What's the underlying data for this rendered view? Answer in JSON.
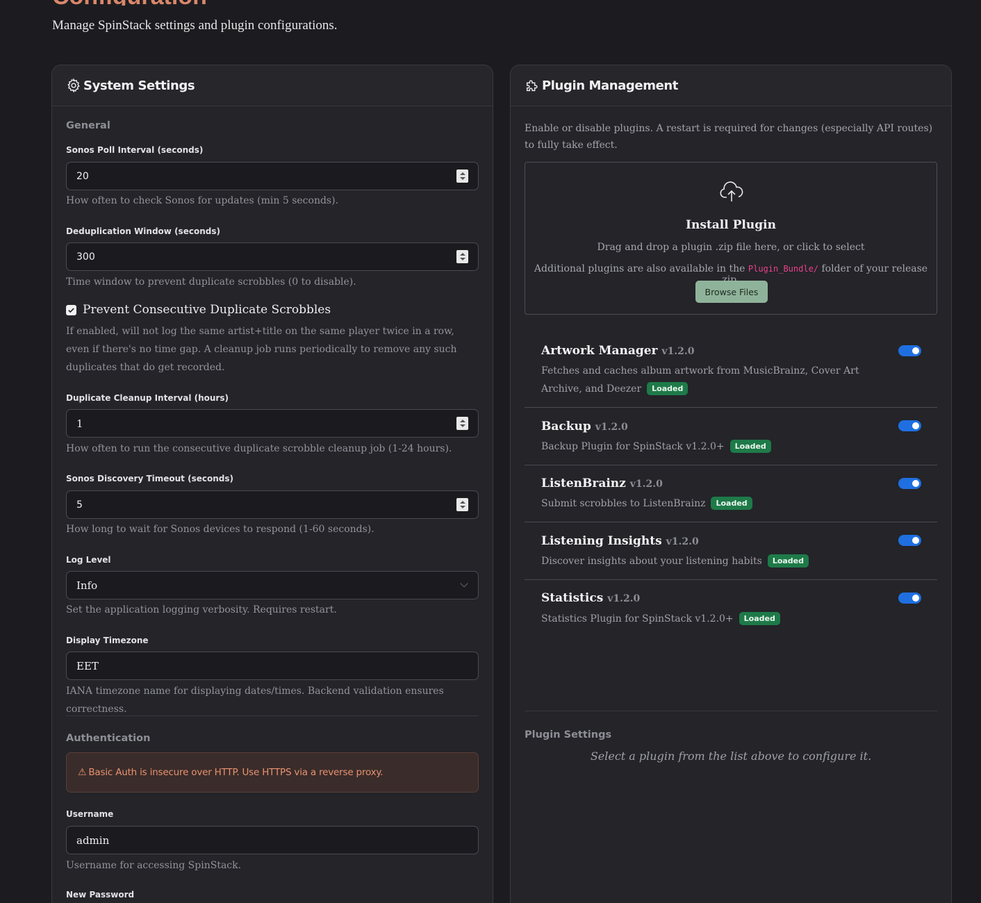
{
  "page": {
    "title": "Configuration",
    "subtitle": "Manage SpinStack settings and plugin configurations."
  },
  "system": {
    "title": "System Settings",
    "icon": "gear-icon",
    "general_title": "General",
    "poll_label": "Sonos Poll Interval (seconds)",
    "poll_value": "20",
    "poll_help": "How often to check Sonos for updates (min 5 seconds).",
    "dedup_label": "Deduplication Window (seconds)",
    "dedup_value": "300",
    "dedup_help": "Time window to prevent duplicate scrobbles (0 to disable).",
    "consecutive_label": "Prevent Consecutive Duplicate Scrobbles",
    "consecutive_checked": true,
    "consecutive_help": "If enabled, will not log the same artist+title on the same player twice in a row, even if there's no time gap. A cleanup job runs periodically to remove any such duplicates that do get recorded.",
    "cleanup_label": "Duplicate Cleanup Interval (hours)",
    "cleanup_value": "1",
    "cleanup_help": "How often to run the consecutive duplicate scrobble cleanup job (1-24 hours).",
    "discovery_label": "Sonos Discovery Timeout (seconds)",
    "discovery_value": "5",
    "discovery_help": "How long to wait for Sonos devices to respond (1-60 seconds).",
    "log_label": "Log Level",
    "log_value": "Info",
    "log_help": "Set the application logging verbosity. Requires restart.",
    "tz_label": "Display Timezone",
    "tz_value": "EET",
    "tz_help": "IANA timezone name for displaying dates/times. Backend validation ensures correctness.",
    "auth_title": "Authentication",
    "auth_warning": "Basic Auth is insecure over HTTP. Use HTTPS via a reverse proxy.",
    "username_label": "Username",
    "username_value": "admin",
    "username_help": "Username for accessing SpinStack.",
    "password_label": "New Password"
  },
  "plugins": {
    "title": "Plugin Management",
    "icon": "puzzle-icon",
    "intro": "Enable or disable plugins. A restart is required for changes (especially API routes) to fully take effect.",
    "install_title": "Install Plugin",
    "install_sub": "Drag and drop a plugin .zip file here, or click to select",
    "install_extra_pre": "Additional plugins are also available in the",
    "install_extra_code": "Plugin_Bundle/",
    "install_extra_post": "folder of your release zip.",
    "browse_label": "Browse Files",
    "items": [
      {
        "name": "Artwork Manager",
        "version": "v1.2.0",
        "description": "Fetches and caches album artwork from MusicBrainz, Cover Art Archive, and Deezer",
        "status": "Loaded",
        "enabled": true
      },
      {
        "name": "Backup",
        "version": "v1.2.0",
        "description": "Backup Plugin for SpinStack v1.2.0+",
        "status": "Loaded",
        "enabled": true
      },
      {
        "name": "ListenBrainz",
        "version": "v1.2.0",
        "description": "Submit scrobbles to ListenBrainz",
        "status": "Loaded",
        "enabled": true
      },
      {
        "name": "Listening Insights",
        "version": "v1.2.0",
        "description": "Discover insights about your listening habits",
        "status": "Loaded",
        "enabled": true
      },
      {
        "name": "Statistics",
        "version": "v1.2.0",
        "description": "Statistics Plugin for SpinStack v1.2.0+",
        "status": "Loaded",
        "enabled": true
      }
    ],
    "settings_title": "Plugin Settings",
    "settings_empty": "Select a plugin from the list above to configure it."
  },
  "colors": {
    "accent": "#d9876a",
    "toggle_on": "#1f6fe0",
    "badge_loaded": "#1e7a48",
    "browse_button": "#8fb39a"
  }
}
